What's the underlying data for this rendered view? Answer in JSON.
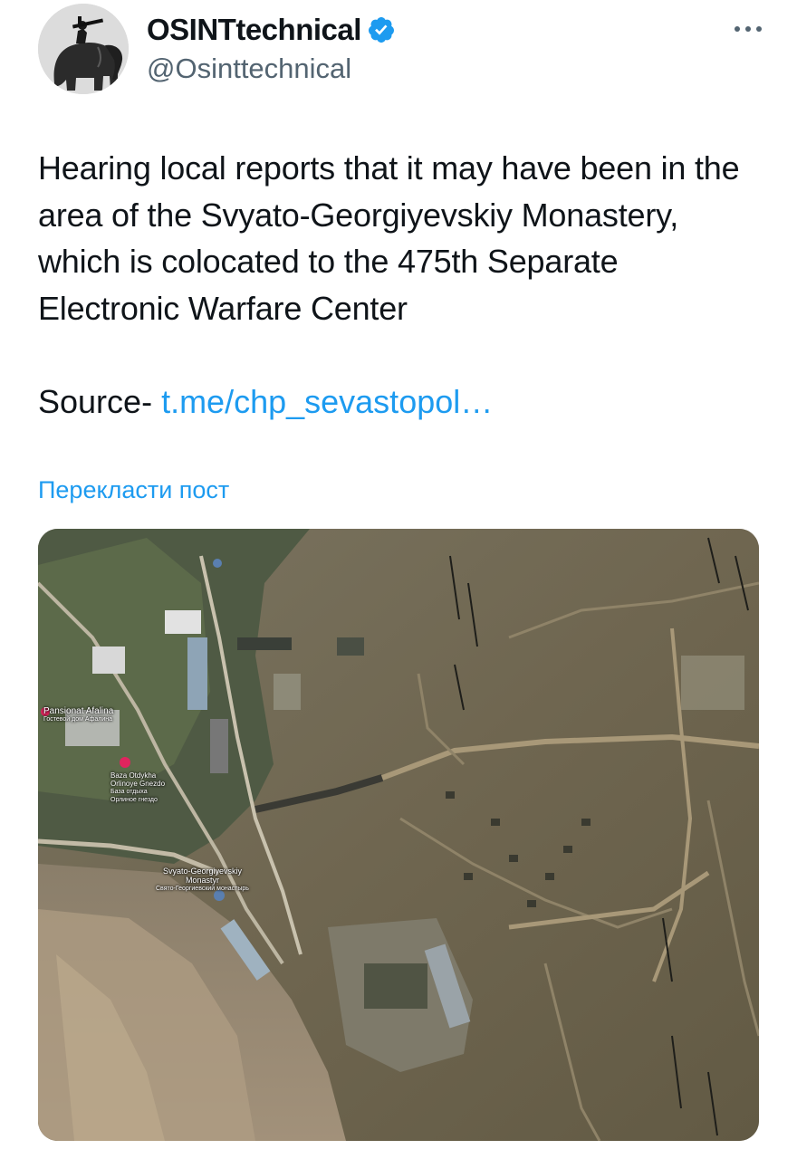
{
  "author": {
    "display_name": "OSINTtechnical",
    "handle": "@Osinttechnical",
    "verified": true,
    "verified_color": "#1d9bf0",
    "avatar_icon": "soldier-on-elephant-avatar"
  },
  "tweet": {
    "text": "Hearing local reports that it may have been in the area of the Svyato-Georgiyevskiy Monastery, which is colocated to the 475th Separate Electronic Warfare Center",
    "source_prefix": "Source- ",
    "source_link": "t.me/chp_sevastopol…",
    "translate_label": "Перекласти пост"
  },
  "map": {
    "label_pansionat": "Pansionat Afalina",
    "label_pansionat_sub": "Гостевой дом Афалина",
    "label_baza": "Baza Otdykha",
    "label_baza_sub": "Orlinoye Gnezdo",
    "label_baza_sub2": "База отдыха",
    "label_baza_sub3": "Орлиное гнездо",
    "label_monastery": "Svyato-Georgiyevskiy",
    "label_monastery_2": "Monastyr",
    "label_monastery_sub": "Свято-Георгиевский монастырь"
  },
  "colors": {
    "link": "#1d9bf0",
    "text": "#0f1419",
    "secondary": "#536471"
  }
}
